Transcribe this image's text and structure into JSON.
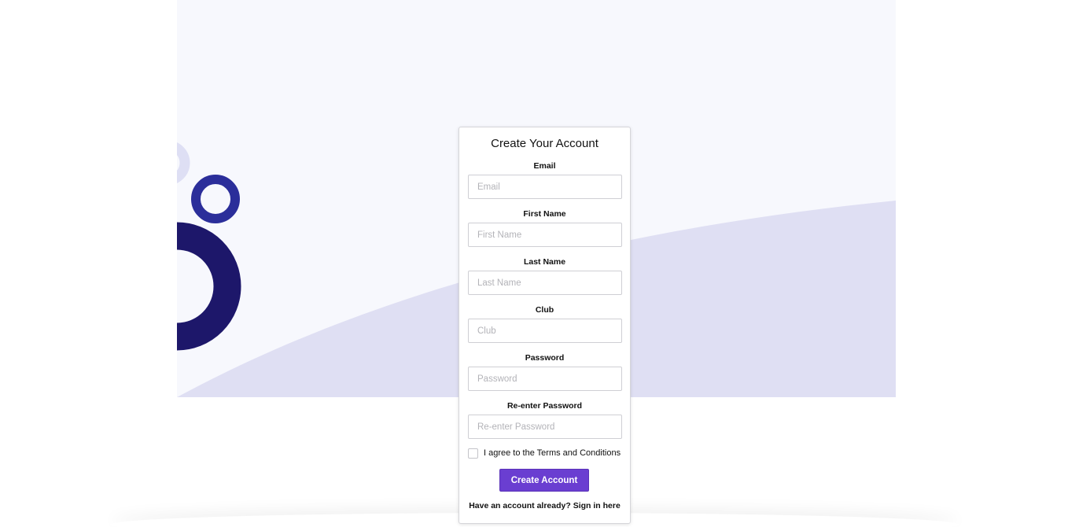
{
  "form": {
    "title": "Create Your Account",
    "fields": [
      {
        "label": "Email",
        "placeholder": "Email",
        "value": ""
      },
      {
        "label": "First Name",
        "placeholder": "First Name",
        "value": ""
      },
      {
        "label": "Last Name",
        "placeholder": "Last Name",
        "value": ""
      },
      {
        "label": "Club",
        "placeholder": "Club",
        "value": ""
      },
      {
        "label": "Password",
        "placeholder": "Password",
        "value": ""
      },
      {
        "label": "Re-enter Password",
        "placeholder": "Re-enter Password",
        "value": ""
      }
    ],
    "terms_label": "I agree to the Terms and Conditions",
    "terms_checked": false,
    "submit_label": "Create Account",
    "signin_prompt": "Have an account already?",
    "signin_link": "Sign in here"
  },
  "colors": {
    "accent": "#6a3ed1",
    "hero_background": "#f7f8fd",
    "hero_wave": "#dfdff3",
    "ring_dark": "#1d176a",
    "ring_mid": "#2b2e9a",
    "ring_light": "#dedff4"
  }
}
